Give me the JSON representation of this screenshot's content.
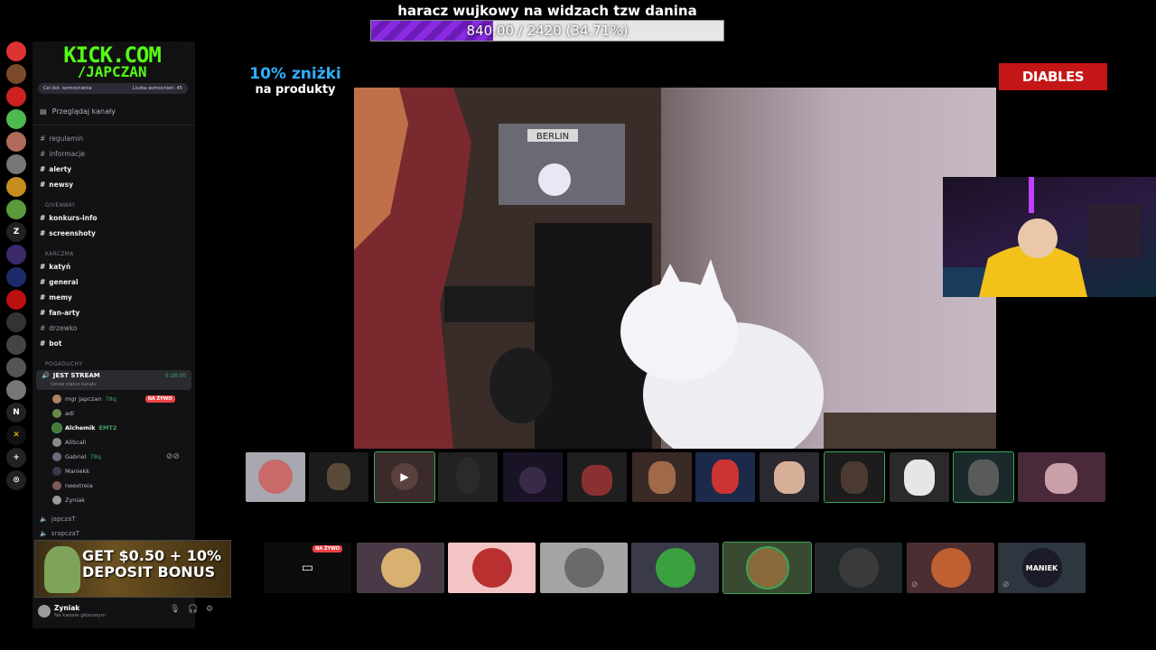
{
  "goal": {
    "title": "haracz wujkowy na widzach tzw danina",
    "progress_text": "840.00 / 2420 (34.71%)",
    "progress": 0.3471
  },
  "brand": {
    "line1": "KICK.COM",
    "line2": "/JAPCZAN"
  },
  "sidebar": {
    "boost_goal": "Cel dot. wzmocnienia",
    "boost_count": "Liczba wzmocnień: 45",
    "browse": "Przeglądaj kanały",
    "channels": [
      {
        "name": "regulamin",
        "bold": false
      },
      {
        "name": "informacje",
        "bold": false
      },
      {
        "name": "alerty",
        "bold": true
      },
      {
        "name": "newsy",
        "bold": true
      }
    ],
    "cat_giveaway": "GIVEAWAY",
    "giveaway_channels": [
      {
        "name": "konkurs-info",
        "bold": true
      },
      {
        "name": "screenshoty",
        "bold": true
      }
    ],
    "cat_karczma": "KARCZMA",
    "karczma_channels": [
      {
        "name": "katyń",
        "bold": true
      },
      {
        "name": "general",
        "bold": true
      },
      {
        "name": "memy",
        "bold": true
      },
      {
        "name": "fan-arty",
        "bold": true
      },
      {
        "name": "drzewko",
        "bold": false
      },
      {
        "name": "bot",
        "bold": true
      }
    ],
    "cat_pogaduchy": "POGADUCHY",
    "voice_channel": "JEST STREAM",
    "voice_time": "5:28:00",
    "voice_status": "Ustaw status kanału",
    "live_label": "NA ŻYWO",
    "voice_users": [
      {
        "name": "mgr Japczan",
        "tag": "78q"
      },
      {
        "name": "adi",
        "tag": ""
      },
      {
        "name": "Alchemik",
        "tag": "EMT2"
      },
      {
        "name": "AliScali",
        "tag": ""
      },
      {
        "name": "Gabriel",
        "tag": "78q"
      },
      {
        "name": "Maniekk",
        "tag": ""
      },
      {
        "name": "neextreia",
        "tag": ""
      },
      {
        "name": "Zyniak",
        "tag": ""
      }
    ],
    "more_channels": [
      "japczaT",
      "srapczaT"
    ],
    "footer_user": "Zyniak",
    "footer_status": "Na kanale głosowym"
  },
  "ad": {
    "line1": "GET $0.50 + 10%",
    "line2": "DEPOSIT BONUS"
  },
  "promo": {
    "line1": "10% zniżki",
    "line2": "na produkty"
  },
  "sponsor": "DIABLES",
  "bottom_row": {
    "live_label": "NA ŻYWO",
    "tile_maniek": "MANIEK"
  },
  "colors": {
    "accent": "#8a2be2",
    "kick_green": "#53fc18",
    "live_red": "#ed4245",
    "online_green": "#3ba55c"
  }
}
